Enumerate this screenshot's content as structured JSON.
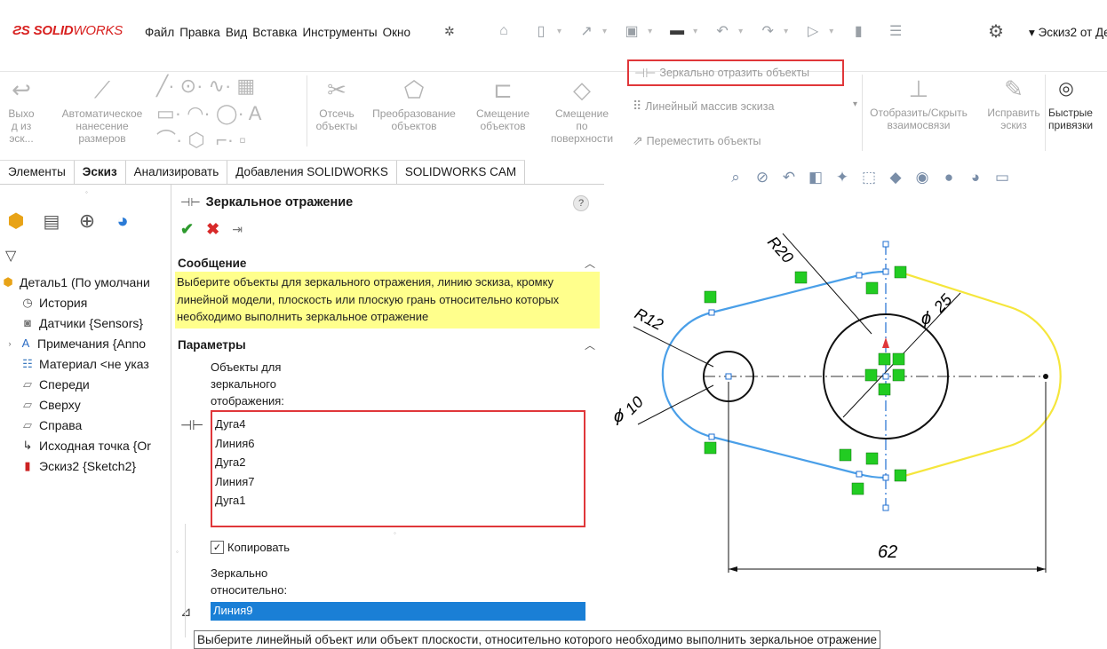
{
  "app": {
    "logo_main": "SOLID",
    "logo_rest": "WORKS",
    "doc_title": "Эскиз2 от Де..."
  },
  "menu": [
    "Файл",
    "Правка",
    "Вид",
    "Вставка",
    "Инструменты",
    "Окно"
  ],
  "ribbon": {
    "exit": [
      "Выхо",
      "д из",
      "эск..."
    ],
    "auto_dim": [
      "Автоматическое",
      "нанесение",
      "размеров"
    ],
    "trim": [
      "Отсечь",
      "объекты"
    ],
    "convert": [
      "Преобразование",
      "объектов"
    ],
    "offset": [
      "Смещение",
      "объектов"
    ],
    "offset_surface": [
      "Смещение",
      "по",
      "поверхности"
    ],
    "mirror": "Зеркально отразить объекты",
    "linear_pattern": "Линейный массив эскиза",
    "move": "Переместить объекты",
    "relations": [
      "Отобразить/Скрыть",
      "взаимосвязи"
    ],
    "repair": [
      "Исправить",
      "эскиз"
    ],
    "quick_snaps": [
      "Быстрые",
      "привязки"
    ]
  },
  "tabs": [
    "Элементы",
    "Эскиз",
    "Анализировать",
    "Добавления SOLIDWORKS",
    "SOLIDWORKS CAM"
  ],
  "active_tab": "Эскиз",
  "tree": {
    "items": [
      {
        "label": "Деталь1 (По умолчани",
        "icon": "part-icon"
      },
      {
        "label": "История",
        "icon": "history-icon"
      },
      {
        "label": "Датчики {Sensors}",
        "icon": "sensors-icon"
      },
      {
        "label": "Примечания {Anno",
        "icon": "annotations-icon"
      },
      {
        "label": "Материал <не указ",
        "icon": "material-icon"
      },
      {
        "label": "Спереди",
        "icon": "plane-icon"
      },
      {
        "label": "Сверху",
        "icon": "plane-icon"
      },
      {
        "label": "Справа",
        "icon": "plane-icon"
      },
      {
        "label": "Исходная точка {Or",
        "icon": "origin-icon"
      },
      {
        "label": "Эскиз2 {Sketch2}",
        "icon": "sketch-icon"
      }
    ]
  },
  "pm": {
    "title": "Зеркальное отражение",
    "help": "?",
    "message_header": "Сообщение",
    "message": "Выберите объекты для зеркального отражения, линию эскиза, кромку линейной модели, плоскость или плоскую грань относительно которых необходимо выполнить зеркальное отражение",
    "params_header": "Параметры",
    "objects_label": [
      "Объекты для",
      "зеркального",
      "отображения:"
    ],
    "objects": [
      "Дуга4",
      "Линия6",
      "Дуга2",
      "Линия7",
      "Дуга1"
    ],
    "copy_label": "Копировать",
    "copy_checked": true,
    "about_label": [
      "Зеркально",
      "относительно:"
    ],
    "about_value": "Линия9"
  },
  "tooltip": "Выберите линейный объект или объект плоскости, относительно которого необходимо выполнить зеркальное отражение",
  "sketch": {
    "dim_r20": "R20",
    "dim_r12": "R12",
    "dim_d25": "25",
    "dim_d10": "10",
    "dim_62": "62",
    "diameter_symbol": "ϕ"
  },
  "colors": {
    "selected_blue": "#4a9fe8",
    "preview_yellow": "#f5e63c",
    "relation_green": "#22cc22",
    "highlight_red": "#e0373a",
    "brand_red": "#d8201f"
  }
}
